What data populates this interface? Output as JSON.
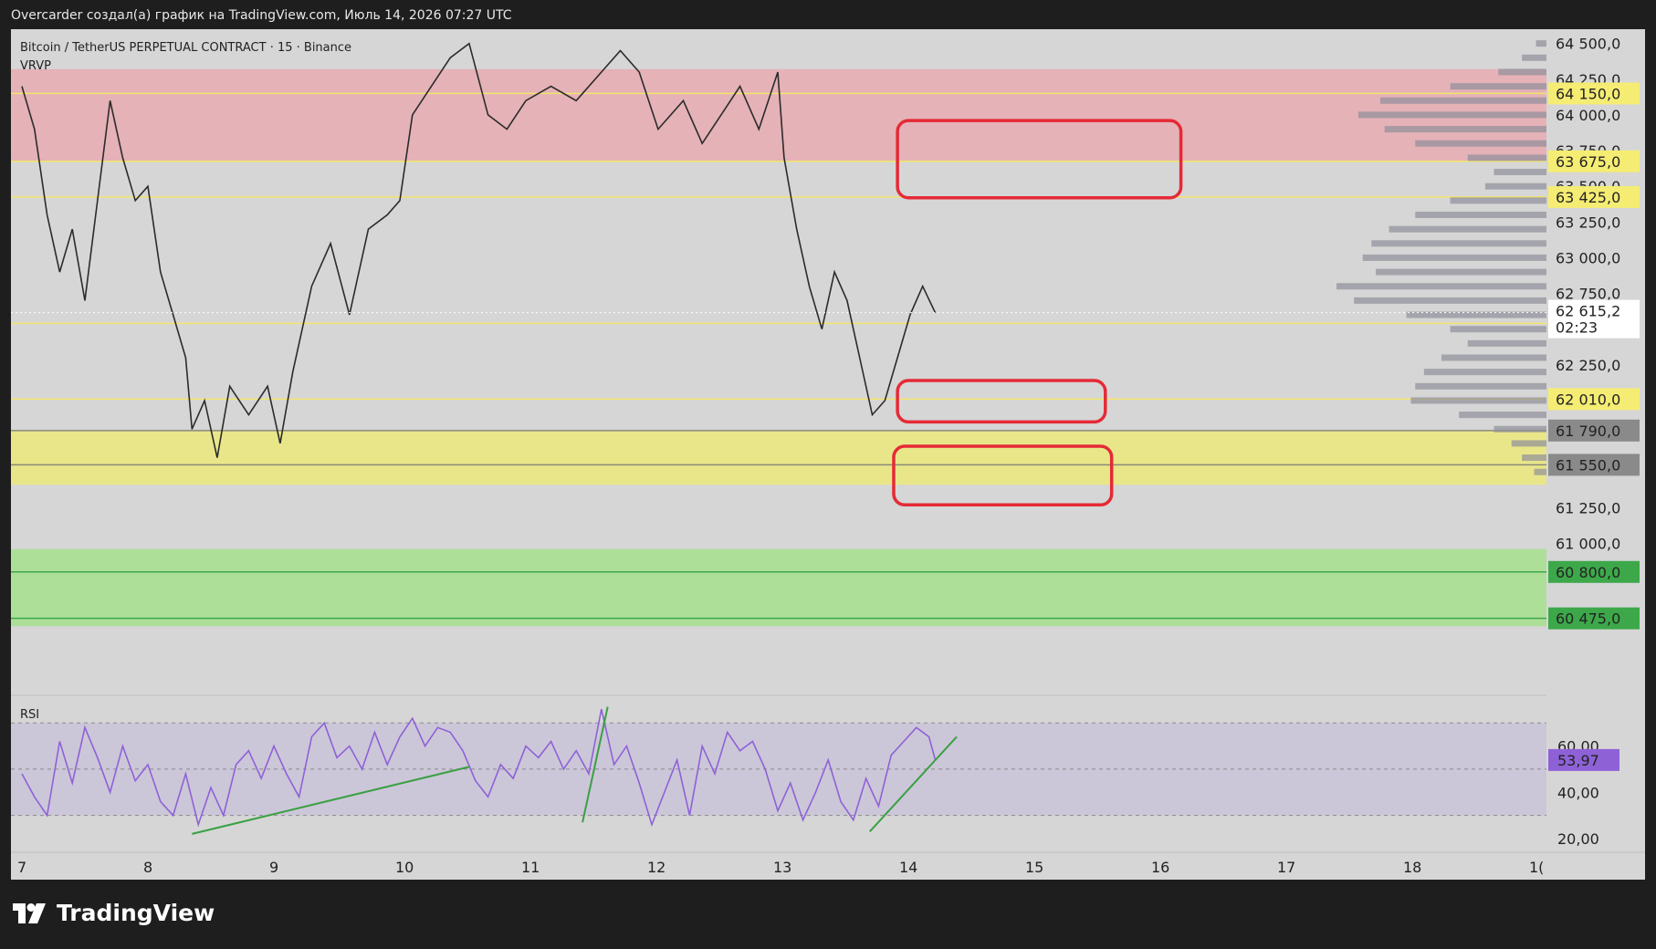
{
  "caption": "Overcarder создал(а) график на TradingView.com, Июль 14, 2026 07:27 UTC",
  "legend": {
    "symbol": "Bitcoin / TetherUS PERPETUAL CONTRACT · 15 · Binance",
    "indicator": "VRVP"
  },
  "rsi_title": "RSI",
  "brand": {
    "name": "TradingView",
    "logo_icon": "tradingview-logo-icon"
  },
  "colors": {
    "background": "#d6d6d6",
    "resistance_zone": "#e7abb2",
    "support_zone": "#ece97c",
    "demand_zone": "#a6e08e",
    "rsi_line": "#8e62d6",
    "markup": "#e52a36",
    "trendline": "#3aa043",
    "level_line": "#f2e56b"
  },
  "chart_data": {
    "type": "candlestick",
    "x_ticks": [
      "7",
      "8",
      "9",
      "10",
      "11",
      "12",
      "13",
      "14",
      "15",
      "16",
      "17",
      "18",
      "1("
    ],
    "price_range": [
      60000,
      64600
    ],
    "price_ticks": [
      "64 500,0",
      "64 250,0",
      "64 000,0",
      "63 750,0",
      "63 500,0",
      "63 250,0",
      "63 000,0",
      "62 750,0",
      "62 250,0",
      "61 250,0",
      "61 000,0"
    ],
    "price_tick_values": [
      64500,
      64250,
      64000,
      63750,
      63500,
      63250,
      63000,
      62750,
      62250,
      61250,
      61000
    ],
    "current_price": {
      "value": "62 615,2",
      "timer": "02:23",
      "price": 62615.2
    },
    "level_labels": [
      {
        "label": "64 150,0",
        "price": 64150,
        "color": "#f5ec74"
      },
      {
        "label": "63 675,0",
        "price": 63675,
        "color": "#f5ec74"
      },
      {
        "label": "63 425,0",
        "price": 63425,
        "color": "#f5ec74"
      },
      {
        "label": "62 540,0",
        "price": 62540,
        "color": "#f5ec74"
      },
      {
        "label": "62 010,0",
        "price": 62010,
        "color": "#f5ec74"
      },
      {
        "label": "61 790,0",
        "price": 61790,
        "color": "#8a8a8a"
      },
      {
        "label": "61 550,0",
        "price": 61550,
        "color": "#8a8a8a"
      },
      {
        "label": "60 800,0",
        "price": 60800,
        "color": "#3da84a"
      },
      {
        "label": "60 475,0",
        "price": 60475,
        "color": "#3da84a"
      }
    ],
    "zones": [
      {
        "name": "resistance",
        "from": 63675,
        "to": 64320,
        "start_day": 7.0
      },
      {
        "name": "support",
        "from": 61410,
        "to": 61790,
        "start_day": 7.0
      },
      {
        "name": "demand",
        "from": 60420,
        "to": 60960,
        "start_day": 7.0
      }
    ],
    "close_series": [
      [
        7.0,
        64200
      ],
      [
        7.1,
        63900
      ],
      [
        7.2,
        63300
      ],
      [
        7.3,
        62900
      ],
      [
        7.4,
        63200
      ],
      [
        7.5,
        62700
      ],
      [
        7.6,
        63400
      ],
      [
        7.7,
        64100
      ],
      [
        7.8,
        63700
      ],
      [
        7.9,
        63400
      ],
      [
        8.0,
        63500
      ],
      [
        8.1,
        62900
      ],
      [
        8.2,
        62600
      ],
      [
        8.3,
        62300
      ],
      [
        8.35,
        61800
      ],
      [
        8.45,
        62000
      ],
      [
        8.55,
        61600
      ],
      [
        8.65,
        62100
      ],
      [
        8.8,
        61900
      ],
      [
        8.95,
        62100
      ],
      [
        9.05,
        61700
      ],
      [
        9.15,
        62200
      ],
      [
        9.3,
        62800
      ],
      [
        9.45,
        63100
      ],
      [
        9.6,
        62600
      ],
      [
        9.75,
        63200
      ],
      [
        9.9,
        63300
      ],
      [
        10.0,
        63400
      ],
      [
        10.1,
        64000
      ],
      [
        10.25,
        64200
      ],
      [
        10.4,
        64400
      ],
      [
        10.55,
        64500
      ],
      [
        10.7,
        64000
      ],
      [
        10.85,
        63900
      ],
      [
        11.0,
        64100
      ],
      [
        11.2,
        64200
      ],
      [
        11.4,
        64100
      ],
      [
        11.6,
        64300
      ],
      [
        11.75,
        64450
      ],
      [
        11.9,
        64300
      ],
      [
        12.05,
        63900
      ],
      [
        12.25,
        64100
      ],
      [
        12.4,
        63800
      ],
      [
        12.55,
        64000
      ],
      [
        12.7,
        64200
      ],
      [
        12.85,
        63900
      ],
      [
        13.0,
        64300
      ],
      [
        13.05,
        63700
      ],
      [
        13.15,
        63200
      ],
      [
        13.25,
        62800
      ],
      [
        13.35,
        62500
      ],
      [
        13.45,
        62900
      ],
      [
        13.55,
        62700
      ],
      [
        13.65,
        62300
      ],
      [
        13.75,
        61900
      ],
      [
        13.85,
        62000
      ],
      [
        13.95,
        62300
      ],
      [
        14.05,
        62600
      ],
      [
        14.15,
        62800
      ],
      [
        14.25,
        62615
      ]
    ],
    "rsi": {
      "ticks": [
        "60,00",
        "40,00",
        "20,00"
      ],
      "tick_values": [
        60,
        40,
        20
      ],
      "range": [
        18,
        78
      ],
      "current": "53,97",
      "current_value": 53.97,
      "band": [
        30,
        70
      ],
      "series": [
        [
          7.0,
          48
        ],
        [
          7.1,
          38
        ],
        [
          7.2,
          30
        ],
        [
          7.3,
          62
        ],
        [
          7.4,
          44
        ],
        [
          7.5,
          68
        ],
        [
          7.6,
          55
        ],
        [
          7.7,
          40
        ],
        [
          7.8,
          60
        ],
        [
          7.9,
          45
        ],
        [
          8.0,
          52
        ],
        [
          8.1,
          36
        ],
        [
          8.2,
          30
        ],
        [
          8.3,
          48
        ],
        [
          8.4,
          26
        ],
        [
          8.5,
          42
        ],
        [
          8.6,
          30
        ],
        [
          8.7,
          52
        ],
        [
          8.8,
          58
        ],
        [
          8.9,
          46
        ],
        [
          9.0,
          60
        ],
        [
          9.1,
          48
        ],
        [
          9.2,
          38
        ],
        [
          9.3,
          64
        ],
        [
          9.4,
          70
        ],
        [
          9.5,
          55
        ],
        [
          9.6,
          60
        ],
        [
          9.7,
          50
        ],
        [
          9.8,
          66
        ],
        [
          9.9,
          52
        ],
        [
          10.0,
          64
        ],
        [
          10.1,
          72
        ],
        [
          10.2,
          60
        ],
        [
          10.3,
          68
        ],
        [
          10.4,
          66
        ],
        [
          10.5,
          58
        ],
        [
          10.6,
          45
        ],
        [
          10.7,
          38
        ],
        [
          10.8,
          52
        ],
        [
          10.9,
          46
        ],
        [
          11.0,
          60
        ],
        [
          11.1,
          55
        ],
        [
          11.2,
          62
        ],
        [
          11.3,
          50
        ],
        [
          11.4,
          58
        ],
        [
          11.5,
          48
        ],
        [
          11.6,
          76
        ],
        [
          11.7,
          52
        ],
        [
          11.8,
          60
        ],
        [
          11.9,
          44
        ],
        [
          12.0,
          26
        ],
        [
          12.1,
          40
        ],
        [
          12.2,
          54
        ],
        [
          12.3,
          30
        ],
        [
          12.4,
          60
        ],
        [
          12.5,
          48
        ],
        [
          12.6,
          66
        ],
        [
          12.7,
          58
        ],
        [
          12.8,
          62
        ],
        [
          12.9,
          50
        ],
        [
          13.0,
          32
        ],
        [
          13.1,
          44
        ],
        [
          13.2,
          28
        ],
        [
          13.3,
          40
        ],
        [
          13.4,
          54
        ],
        [
          13.5,
          36
        ],
        [
          13.6,
          28
        ],
        [
          13.7,
          46
        ],
        [
          13.8,
          34
        ],
        [
          13.9,
          56
        ],
        [
          14.0,
          62
        ],
        [
          14.1,
          68
        ],
        [
          14.2,
          64
        ],
        [
          14.25,
          54
        ]
      ]
    },
    "volume_profile": {
      "rows": [
        [
          64500,
          12
        ],
        [
          64400,
          28
        ],
        [
          64300,
          55
        ],
        [
          64200,
          110
        ],
        [
          64100,
          190
        ],
        [
          64000,
          215
        ],
        [
          63900,
          185
        ],
        [
          63800,
          150
        ],
        [
          63700,
          90
        ],
        [
          63600,
          60
        ],
        [
          63500,
          70
        ],
        [
          63400,
          110
        ],
        [
          63300,
          150
        ],
        [
          63200,
          180
        ],
        [
          63100,
          200
        ],
        [
          63000,
          210
        ],
        [
          62900,
          195
        ],
        [
          62800,
          240
        ],
        [
          62700,
          220
        ],
        [
          62600,
          160
        ],
        [
          62500,
          110
        ],
        [
          62400,
          90
        ],
        [
          62300,
          120
        ],
        [
          62200,
          140
        ],
        [
          62100,
          150
        ],
        [
          62000,
          155
        ],
        [
          61900,
          100
        ],
        [
          61800,
          60
        ],
        [
          61700,
          40
        ],
        [
          61600,
          28
        ],
        [
          61500,
          14
        ]
      ]
    },
    "annotations": {
      "boxes": [
        {
          "day_from": 13.95,
          "day_to": 16.2,
          "price_from": 63420,
          "price_to": 63960
        },
        {
          "day_from": 13.95,
          "day_to": 15.6,
          "price_from": 61850,
          "price_to": 62140
        },
        {
          "day_from": 13.92,
          "day_to": 15.65,
          "price_from": 61270,
          "price_to": 61680
        }
      ],
      "trendlines": [
        [
          8.35,
          22,
          10.55,
          51
        ],
        [
          11.45,
          27,
          11.65,
          77
        ],
        [
          13.73,
          23,
          14.42,
          64
        ]
      ]
    }
  }
}
